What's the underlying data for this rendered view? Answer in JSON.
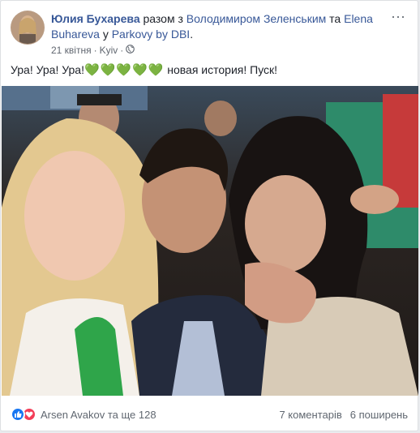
{
  "post": {
    "author": "Юлия Бухарева",
    "with_text": " разом з ",
    "tagged_1": "Володимиром Зеленським",
    "and_text": " та ",
    "tagged_2": "Elena Buhareva",
    "at_text": " у ",
    "place": "Parkovy by DBI",
    "period": ".",
    "date": "21 квітня",
    "dot": "·",
    "location": "Kyiv",
    "more_icon": "···",
    "text": "Ура! Ура! Ура!",
    "hearts": "💚💚💚💚💚",
    "text_after": " новая история! Пуск!"
  },
  "footer": {
    "reactors": "Arsen Avakov та ще 128",
    "comments": "7 коментарів",
    "shares": "6 поширень"
  },
  "colors": {
    "link": "#385898",
    "like": "#1877f2",
    "love": "#f33e58",
    "heart": "#2ecc40"
  }
}
